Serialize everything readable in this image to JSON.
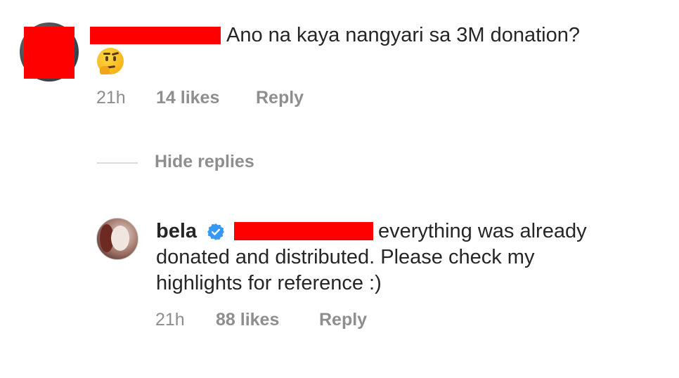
{
  "comment": {
    "text": "Ano na kaya nangyari sa 3M donation?",
    "emoji_icon": "thinking-face-icon",
    "time": "21h",
    "likes": "14 likes",
    "reply_label": "Reply"
  },
  "hide_replies_label": "Hide replies",
  "reply": {
    "username": "bela",
    "verified_icon": "verified-badge-icon",
    "line1": "everything was already",
    "line2": "donated and distributed. Please check my",
    "line3": "highlights for reference :)",
    "time": "21h",
    "likes": "88 likes",
    "reply_label": "Reply"
  },
  "colors": {
    "redaction": "#ff0000",
    "verified": "#3897f0",
    "meta_text": "#8e8e8e"
  }
}
